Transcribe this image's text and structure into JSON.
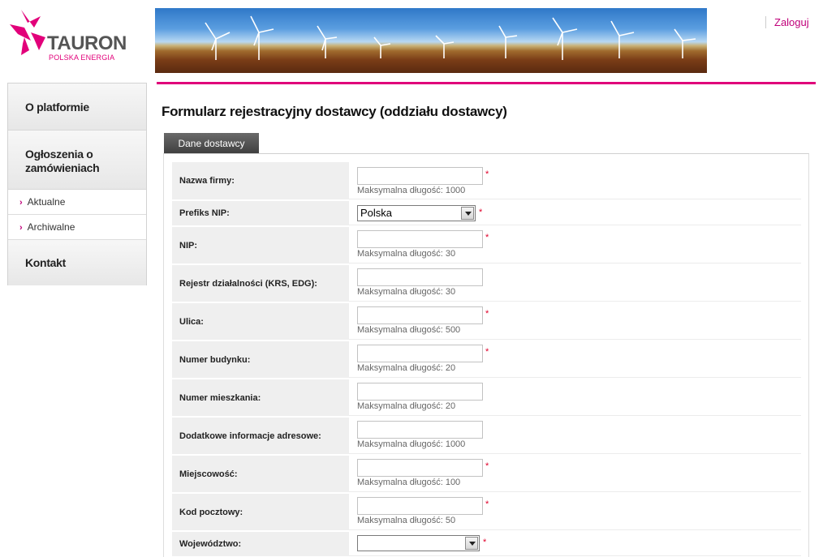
{
  "brand": {
    "name": "TAURON",
    "tagline": "POLSKA ENERGIA",
    "accent": "#e2007a"
  },
  "header": {
    "login_label": "Zaloguj"
  },
  "sidebar": {
    "items": [
      {
        "label": "O platformie"
      },
      {
        "label": "Ogłoszenia o zamówieniach"
      },
      {
        "label": "Aktualne"
      },
      {
        "label": "Archiwalne"
      },
      {
        "label": "Kontakt"
      }
    ]
  },
  "main": {
    "title": "Formularz rejestracyjny dostawcy (oddziału dostawcy)",
    "tab_label": "Dane dostawcy"
  },
  "form": {
    "rows": [
      {
        "label": "Nazwa firmy:",
        "hint": "Maksymalna długość: 1000",
        "required": true
      },
      {
        "label": "Prefiks NIP:",
        "select_value": "Polska",
        "required": true
      },
      {
        "label": "NIP:",
        "hint": "Maksymalna długość: 30",
        "required": true
      },
      {
        "label": "Rejestr działalności (KRS, EDG):",
        "hint": "Maksymalna długość: 30",
        "required": false
      },
      {
        "label": "Ulica:",
        "hint": "Maksymalna długość: 500",
        "required": true
      },
      {
        "label": "Numer budynku:",
        "hint": "Maksymalna długość: 20",
        "required": true
      },
      {
        "label": "Numer mieszkania:",
        "hint": "Maksymalna długość: 20",
        "required": false
      },
      {
        "label": "Dodatkowe informacje adresowe:",
        "hint": "Maksymalna długość: 1000",
        "required": false
      },
      {
        "label": "Miejscowość:",
        "hint": "Maksymalna długość: 100",
        "required": true
      },
      {
        "label": "Kod pocztowy:",
        "hint": "Maksymalna długość: 50",
        "required": true
      },
      {
        "label": "Województwo:",
        "select_value": "",
        "required": true
      }
    ],
    "required_mark": "*"
  }
}
